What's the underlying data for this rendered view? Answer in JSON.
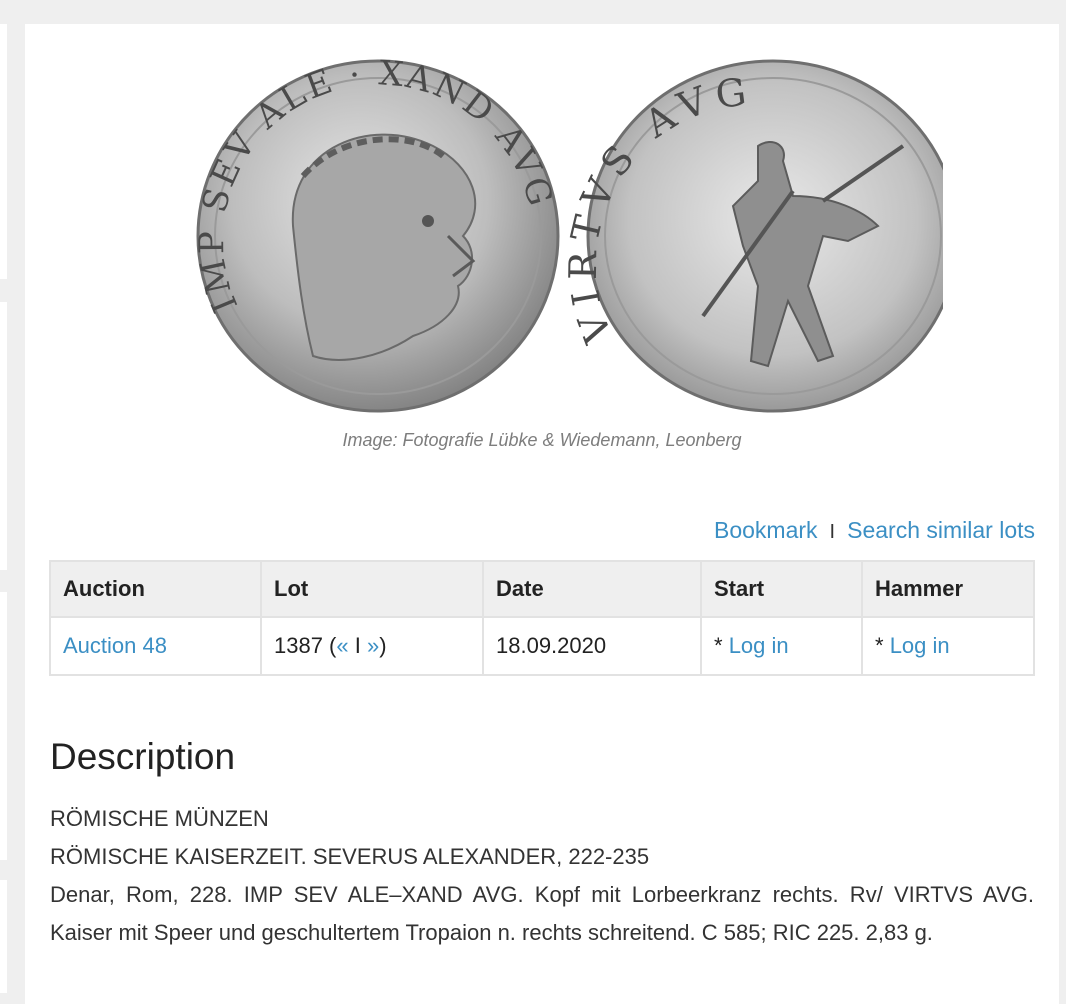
{
  "image_credit": "Image: Fotografie Lübke & Wiedemann, Leonberg",
  "coins": {
    "obverse_legend_left": "IMP SEV ALE",
    "obverse_legend_right": "XAND AVG",
    "reverse_legend": "VIRTVS AVG"
  },
  "actions": {
    "bookmark": "Bookmark",
    "separator": "I",
    "search_similar": "Search similar lots"
  },
  "table": {
    "headers": {
      "auction": "Auction",
      "lot": "Lot",
      "date": "Date",
      "start": "Start",
      "hammer": "Hammer"
    },
    "row": {
      "auction": "Auction 48",
      "lot_number": "1387 (",
      "prev": "«",
      "lot_sep": " I ",
      "next": "»",
      "lot_close": ")",
      "date": "18.09.2020",
      "start_prefix": "* ",
      "start_link": "Log in",
      "hammer_prefix": "* ",
      "hammer_link": "Log in"
    }
  },
  "description": {
    "title": "Description",
    "line1": "RÖMISCHE MÜNZEN",
    "line2": "RÖMISCHE KAISERZEIT. SEVERUS ALEXANDER, 222-235",
    "line3": "Denar, Rom, 228. IMP SEV ALE–XAND AVG. Kopf mit Lorbeerkranz rechts. Rv/ VIRTVS AVG. Kaiser mit Speer und geschultertem Tropaion n. rechts schreitend. C 585; RIC 225. 2,83 g."
  }
}
